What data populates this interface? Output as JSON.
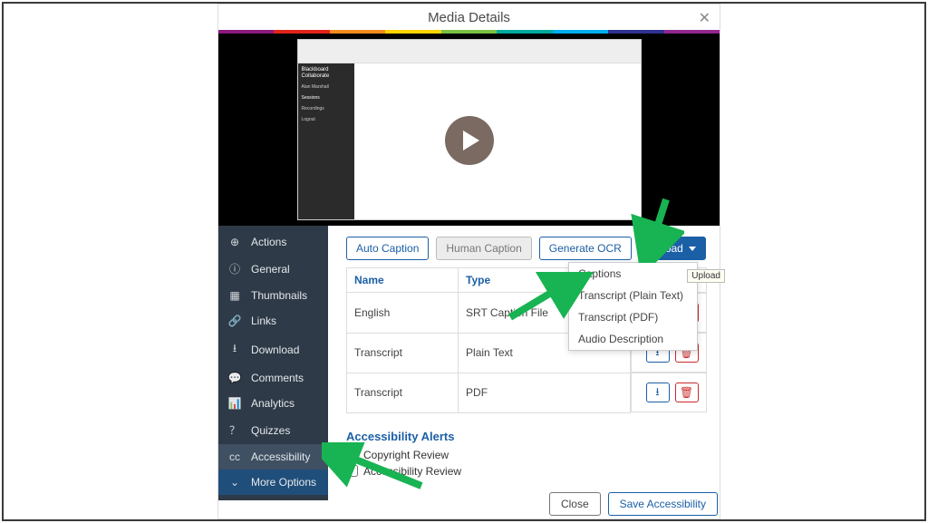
{
  "header": {
    "title": "Media Details"
  },
  "rainbow": [
    "#8b1a7f",
    "#e2231a",
    "#f68b1f",
    "#ffd400",
    "#7ac143",
    "#00a99d",
    "#00aeef",
    "#2e3192",
    "#92278f"
  ],
  "video": {
    "brand": "Blackboard Collaborate",
    "menu": [
      "Alan Marshall",
      "Sessions",
      "Recordings",
      "Logout"
    ]
  },
  "sidebar": [
    {
      "icon": "⊕",
      "label": "Actions",
      "name": "actions"
    },
    {
      "icon": "ⓘ",
      "label": "General",
      "name": "general"
    },
    {
      "icon": "▦",
      "label": "Thumbnails",
      "name": "thumbnails"
    },
    {
      "icon": "🔗",
      "label": "Links",
      "name": "links"
    },
    {
      "icon": "⭳",
      "label": "Download",
      "name": "download"
    },
    {
      "icon": "💬",
      "label": "Comments",
      "name": "comments"
    },
    {
      "icon": "📊",
      "label": "Analytics",
      "name": "analytics"
    },
    {
      "icon": "？",
      "label": "Quizzes",
      "name": "quizzes"
    },
    {
      "icon": "cc",
      "label": "Accessibility",
      "name": "accessibility",
      "active": true
    },
    {
      "icon": "⌄",
      "label": "More Options",
      "name": "more-options",
      "more": true
    }
  ],
  "buttons": {
    "auto_caption": "Auto Caption",
    "human_caption": "Human Caption",
    "generate_ocr": "Generate OCR",
    "upload": "Upload"
  },
  "upload_menu": [
    "Captions",
    "Transcript (Plain Text)",
    "Transcript (PDF)",
    "Audio Description"
  ],
  "tooltip": "Upload",
  "table": {
    "headers": {
      "name": "Name",
      "type": "Type"
    },
    "rows": [
      {
        "name": "English",
        "type": "SRT Caption File"
      },
      {
        "name": "Transcript",
        "type": "Plain Text"
      },
      {
        "name": "Transcript",
        "type": "PDF"
      }
    ]
  },
  "alerts": {
    "title": "Accessibility Alerts",
    "copyright": "Copyright Review",
    "accessibility": "Accessibility Review"
  },
  "footer": {
    "close": "Close",
    "save": "Save Accessibility"
  }
}
